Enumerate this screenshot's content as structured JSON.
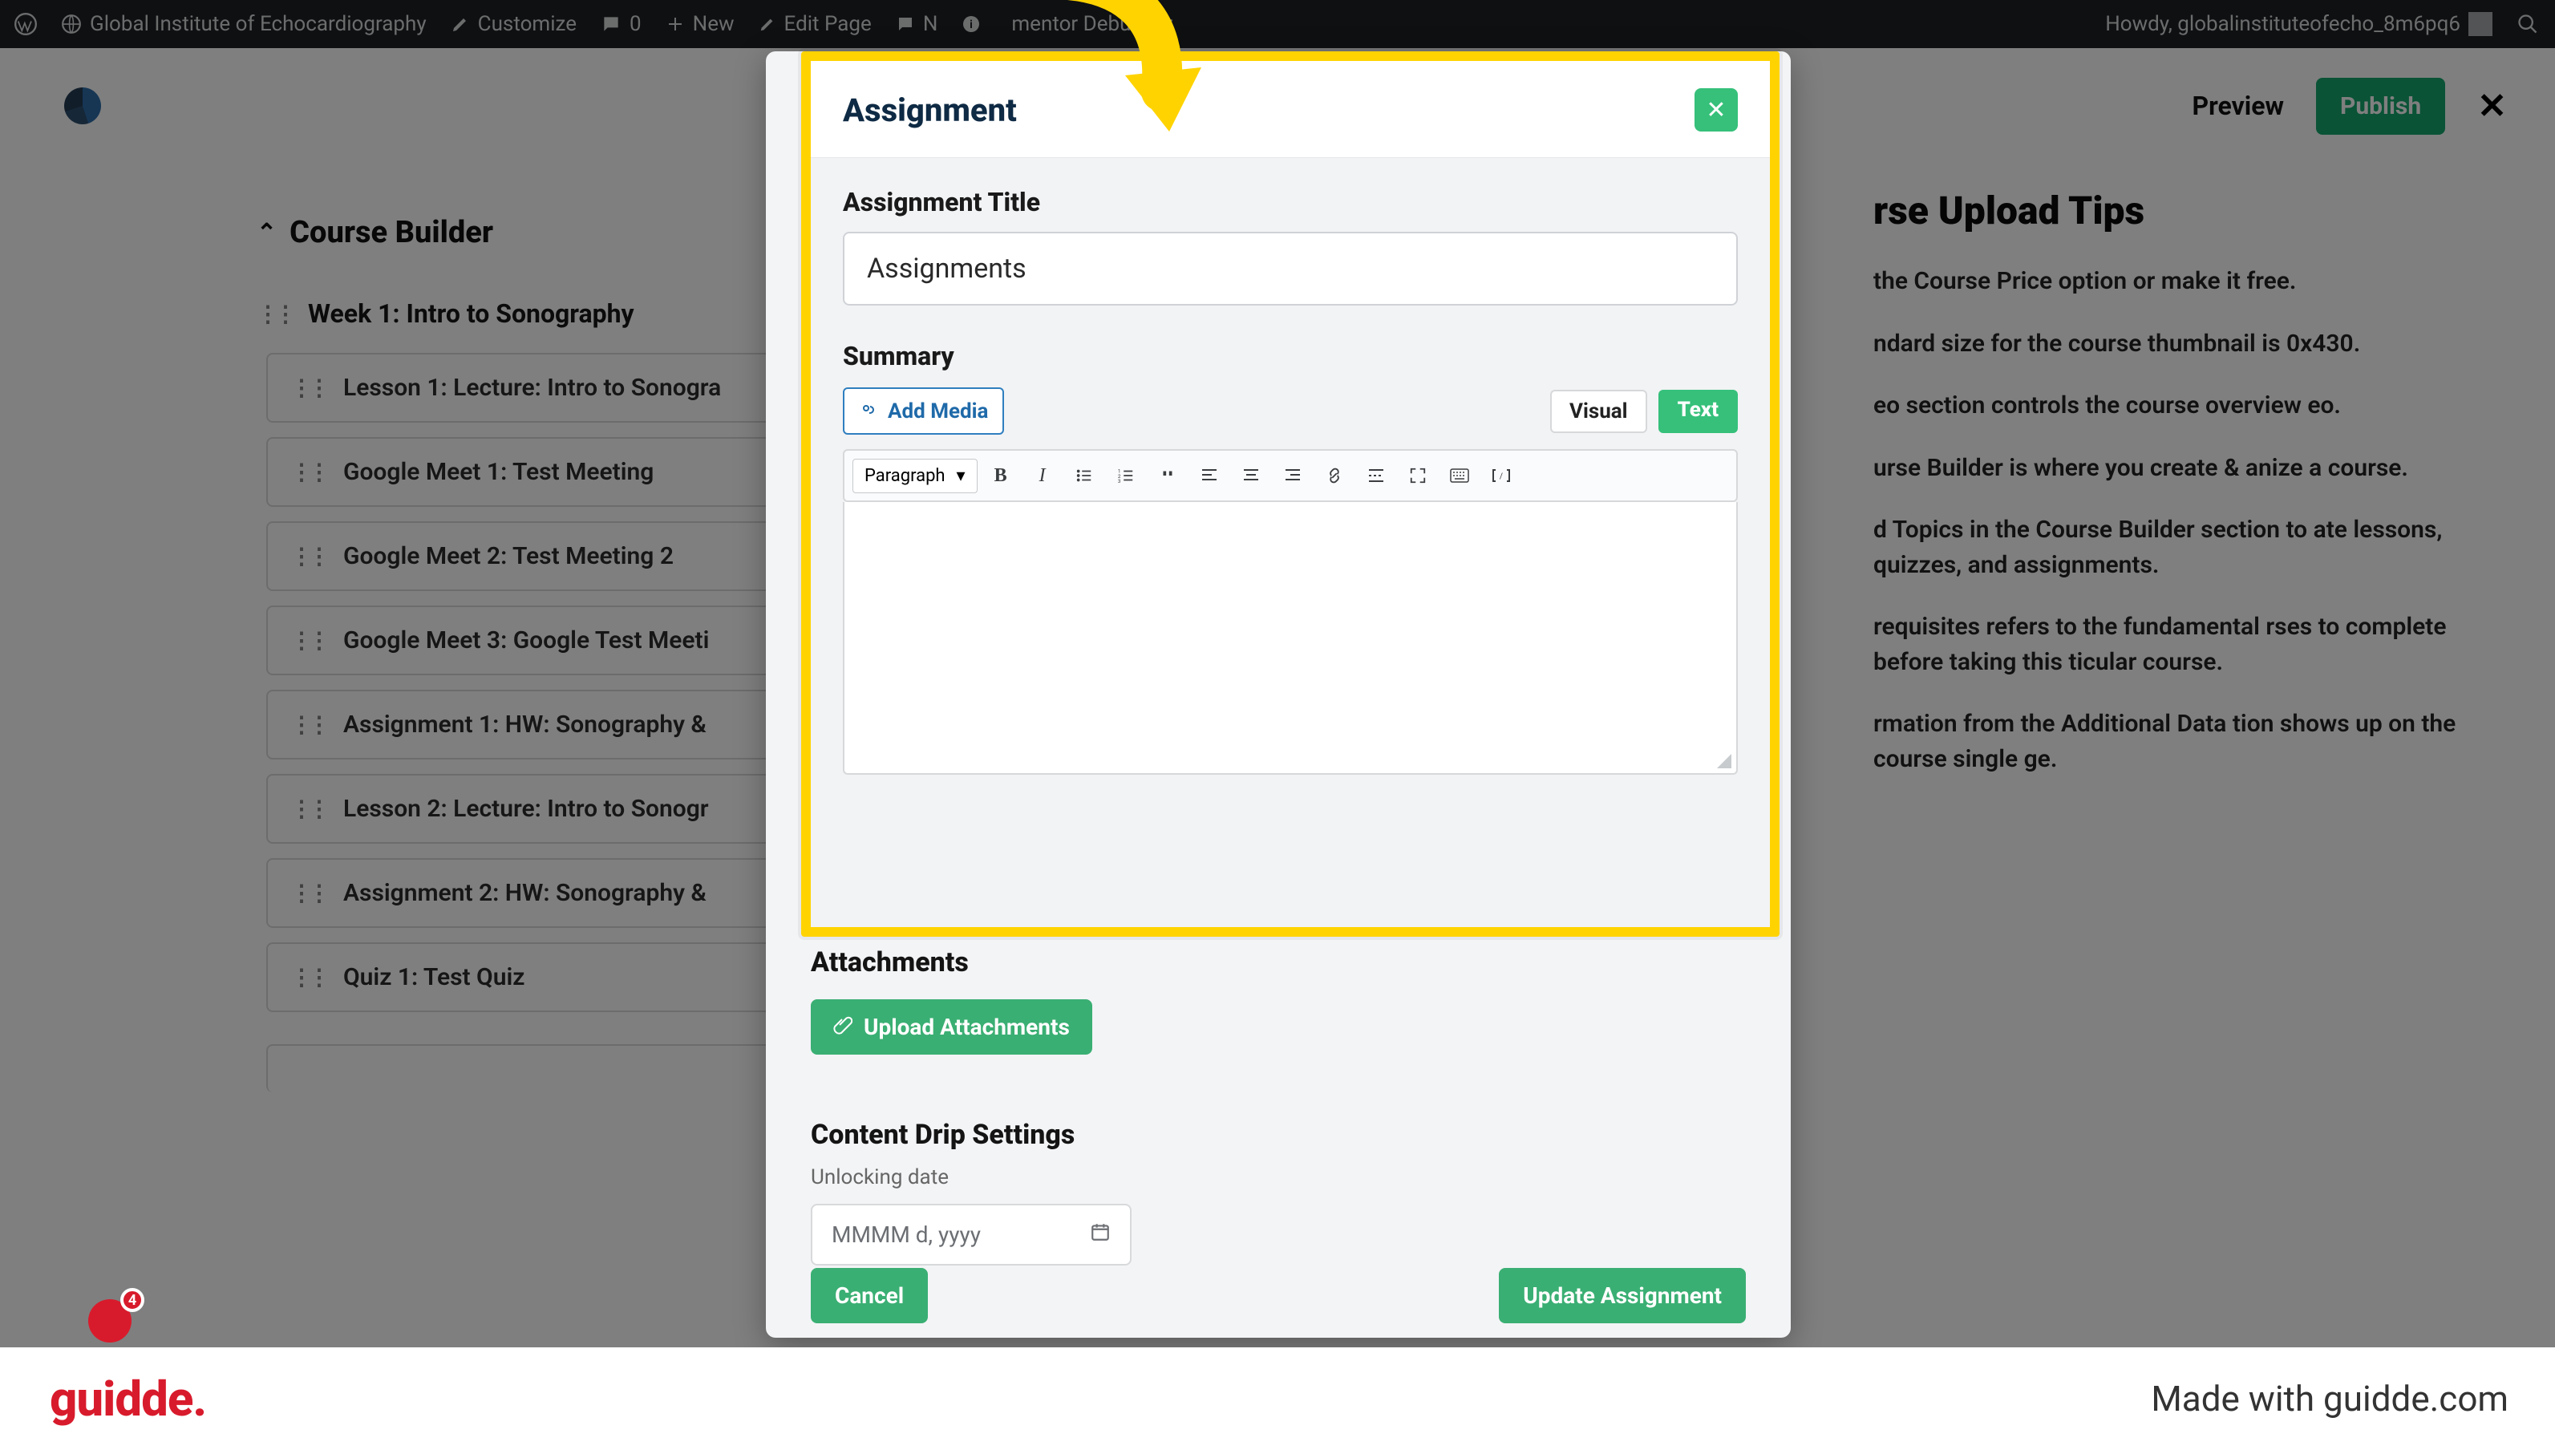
{
  "adminbar": {
    "site": "Global Institute of Echocardiography",
    "customize": "Customize",
    "comments": "0",
    "new": "New",
    "edit_page": "Edit Page",
    "n_item": "N",
    "debugger": "mentor Debugger",
    "howdy": "Howdy, globalinstituteofecho_8m6pq6"
  },
  "pagehead": {
    "preview": "Preview",
    "publish": "Publish"
  },
  "builder": {
    "heading": "Course Builder",
    "topic": "Week 1: Intro to Sonography",
    "rows": [
      "Lesson 1: Lecture: Intro to Sonogra",
      "Google Meet 1: Test Meeting",
      "Google Meet 2: Test Meeting 2",
      "Google Meet 3: Google Test Meeti",
      "Assignment 1: HW: Sonography &",
      "Lesson 2: Lecture: Intro to Sonogr",
      "Assignment 2: HW: Sonography &",
      "Quiz 1: Test Quiz"
    ]
  },
  "tips": {
    "heading": "rse Upload Tips",
    "items": [
      "the Course Price option or make it free.",
      "ndard size for the course thumbnail is 0x430.",
      "eo section controls the course overview eo.",
      "urse Builder is where you create & anize a course.",
      "d Topics in the Course Builder section to ate lessons, quizzes, and assignments.",
      "requisites refers to the fundamental rses to complete before taking this ticular course.",
      "rmation from the Additional Data tion shows up on the course single ge."
    ]
  },
  "modal": {
    "title": "Assignment",
    "field_title_label": "Assignment Title",
    "field_title_value": "Assignments",
    "summary_label": "Summary",
    "add_media": "Add Media",
    "visual": "Visual",
    "text_tab": "Text",
    "paragraph": "Paragraph",
    "attachments_heading": "Attachments",
    "upload_label": "Upload Attachments",
    "drip_heading": "Content Drip Settings",
    "unlock_label": "Unlocking date",
    "date_placeholder": "MMMM d, yyyy",
    "cancel": "Cancel",
    "update": "Update Assignment"
  },
  "badge": {
    "count": "4"
  },
  "footer": {
    "brand": "guidde.",
    "made": "Made with guidde.com"
  }
}
